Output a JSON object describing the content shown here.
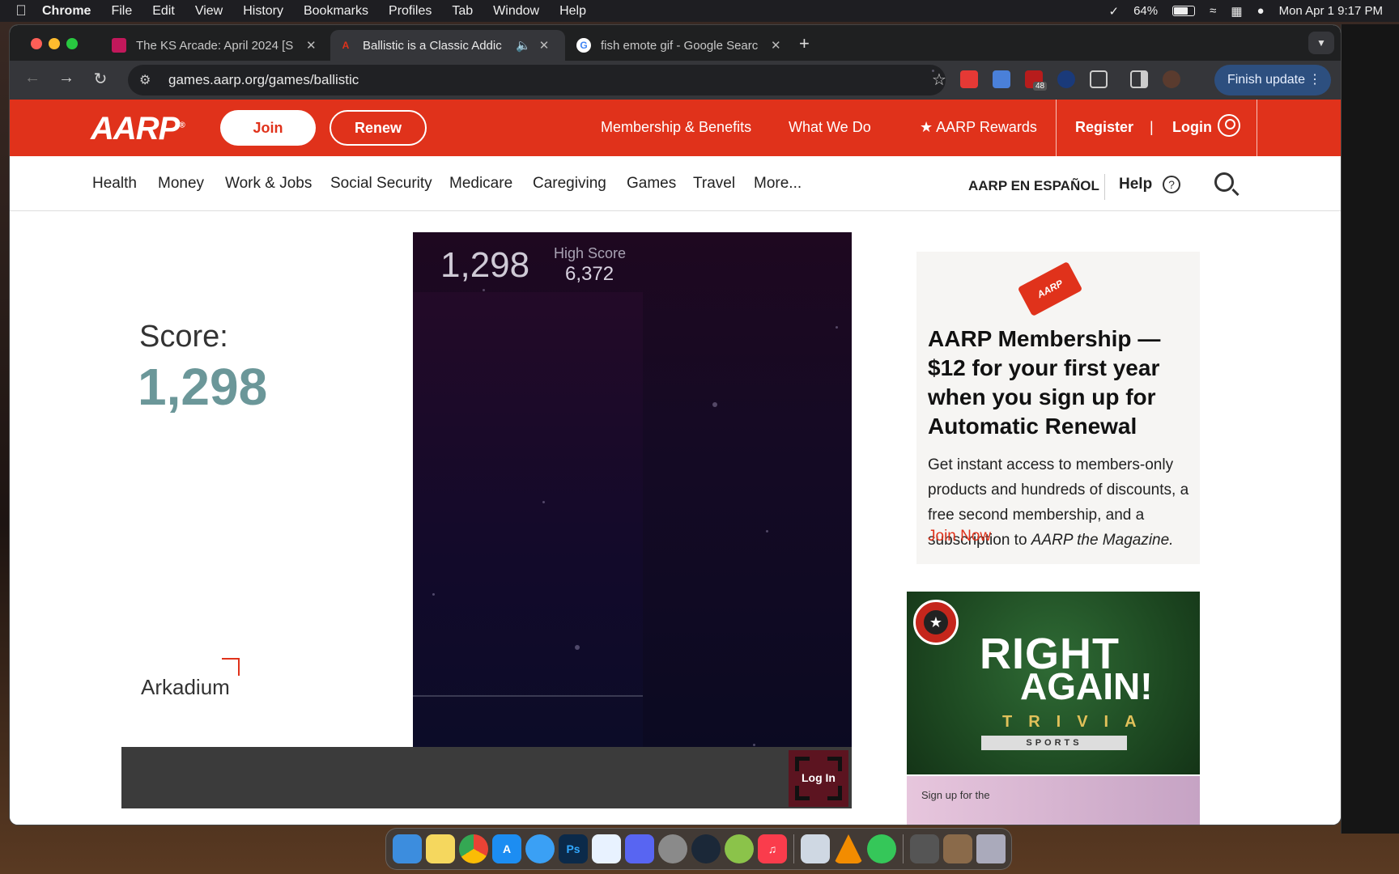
{
  "menubar": {
    "app": "Chrome",
    "items": [
      "File",
      "Edit",
      "View",
      "History",
      "Bookmarks",
      "Profiles",
      "Tab",
      "Window",
      "Help"
    ],
    "battery": "64%",
    "battery_level": 0.64,
    "datetime": "Mon Apr 1  9:17 PM"
  },
  "tabs": [
    {
      "title": "The KS Arcade: April 2024 [S",
      "favicon_color": "#c2185b"
    },
    {
      "title": "Ballistic is a Classic Addic",
      "favicon_color": "#e0321b"
    },
    {
      "title": "fish emote gif - Google Searc",
      "favicon_color": "#4285f4"
    }
  ],
  "toolbar": {
    "url": "games.aarp.org/games/ballistic",
    "badge_count": "48",
    "finish_update": "Finish update"
  },
  "aarp": {
    "logo": "AARP",
    "join": "Join",
    "renew": "Renew",
    "links": {
      "membership": "Membership & Benefits",
      "what_we_do": "What We Do",
      "rewards": "★ AARP Rewards",
      "register": "Register",
      "separator": "|",
      "login": "Login"
    },
    "categories": [
      "Health",
      "Money",
      "Work & Jobs",
      "Social Security",
      "Medicare",
      "Caregiving",
      "Games",
      "Travel",
      "More..."
    ],
    "espanol": "AARP EN ESPAÑOL",
    "help": "Help"
  },
  "score_panel": {
    "label": "Score:",
    "value": "1,298",
    "brand": "Arkadium"
  },
  "game": {
    "score": "1,298",
    "high_score_label": "High Score",
    "high_score": "6,372",
    "login": "Log In"
  },
  "promo": {
    "card_text": "AARP",
    "title": "AARP Membership — $12 for your first year when you sign up for Automatic Renewal",
    "body": "Get instant access to members-only products and hundreds of discounts, a free second membership, and a subscription to",
    "magazine": "AARP the Magazine.",
    "cta": "Join Now"
  },
  "ad": {
    "line1": "RIGHT",
    "line2": "AGAIN!",
    "line3": "TRIVIA",
    "line4": "SPORTS",
    "ad2_text": "Sign up for the"
  }
}
